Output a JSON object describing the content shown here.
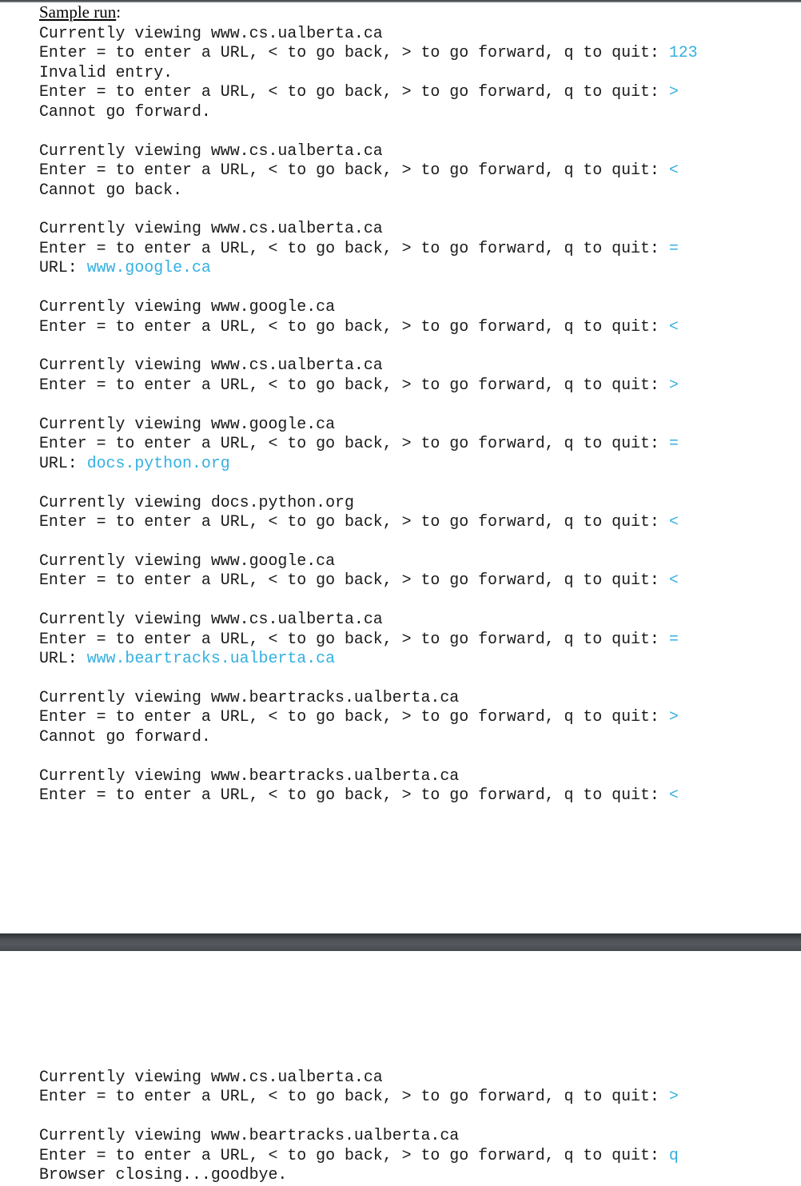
{
  "document": {
    "heading": "Sample run",
    "heading_suffix": ":",
    "input_color": "#35b0e0",
    "page1_lines": [
      {
        "text": "Currently viewing www.cs.ualberta.ca",
        "input": ""
      },
      {
        "text": "Enter = to enter a URL, < to go back, > to go forward, q to quit: ",
        "input": "123"
      },
      {
        "text": "Invalid entry.",
        "input": ""
      },
      {
        "text": "Enter = to enter a URL, < to go back, > to go forward, q to quit: ",
        "input": ">"
      },
      {
        "text": "Cannot go forward.",
        "input": ""
      },
      {
        "text": "",
        "input": ""
      },
      {
        "text": "Currently viewing www.cs.ualberta.ca",
        "input": ""
      },
      {
        "text": "Enter = to enter a URL, < to go back, > to go forward, q to quit: ",
        "input": "<"
      },
      {
        "text": "Cannot go back.",
        "input": ""
      },
      {
        "text": "",
        "input": ""
      },
      {
        "text": "Currently viewing www.cs.ualberta.ca",
        "input": ""
      },
      {
        "text": "Enter = to enter a URL, < to go back, > to go forward, q to quit: ",
        "input": "="
      },
      {
        "text": "URL: ",
        "input": "www.google.ca"
      },
      {
        "text": "",
        "input": ""
      },
      {
        "text": "Currently viewing www.google.ca",
        "input": ""
      },
      {
        "text": "Enter = to enter a URL, < to go back, > to go forward, q to quit: ",
        "input": "<"
      },
      {
        "text": "",
        "input": ""
      },
      {
        "text": "Currently viewing www.cs.ualberta.ca",
        "input": ""
      },
      {
        "text": "Enter = to enter a URL, < to go back, > to go forward, q to quit: ",
        "input": ">"
      },
      {
        "text": "",
        "input": ""
      },
      {
        "text": "Currently viewing www.google.ca",
        "input": ""
      },
      {
        "text": "Enter = to enter a URL, < to go back, > to go forward, q to quit: ",
        "input": "="
      },
      {
        "text": "URL: ",
        "input": "docs.python.org"
      },
      {
        "text": "",
        "input": ""
      },
      {
        "text": "Currently viewing docs.python.org",
        "input": ""
      },
      {
        "text": "Enter = to enter a URL, < to go back, > to go forward, q to quit: ",
        "input": "<"
      },
      {
        "text": "",
        "input": ""
      },
      {
        "text": "Currently viewing www.google.ca",
        "input": ""
      },
      {
        "text": "Enter = to enter a URL, < to go back, > to go forward, q to quit: ",
        "input": "<"
      },
      {
        "text": "",
        "input": ""
      },
      {
        "text": "Currently viewing www.cs.ualberta.ca",
        "input": ""
      },
      {
        "text": "Enter = to enter a URL, < to go back, > to go forward, q to quit: ",
        "input": "="
      },
      {
        "text": "URL: ",
        "input": "www.beartracks.ualberta.ca"
      },
      {
        "text": "",
        "input": ""
      },
      {
        "text": "Currently viewing www.beartracks.ualberta.ca",
        "input": ""
      },
      {
        "text": "Enter = to enter a URL, < to go back, > to go forward, q to quit: ",
        "input": ">"
      },
      {
        "text": "Cannot go forward.",
        "input": ""
      },
      {
        "text": "",
        "input": ""
      },
      {
        "text": "Currently viewing www.beartracks.ualberta.ca",
        "input": ""
      },
      {
        "text": "Enter = to enter a URL, < to go back, > to go forward, q to quit: ",
        "input": "<"
      }
    ],
    "page2_lines": [
      {
        "text": "Currently viewing www.cs.ualberta.ca",
        "input": ""
      },
      {
        "text": "Enter = to enter a URL, < to go back, > to go forward, q to quit: ",
        "input": ">"
      },
      {
        "text": "",
        "input": ""
      },
      {
        "text": "Currently viewing www.beartracks.ualberta.ca",
        "input": ""
      },
      {
        "text": "Enter = to enter a URL, < to go back, > to go forward, q to quit: ",
        "input": "q"
      },
      {
        "text": "Browser closing...goodbye.",
        "input": ""
      }
    ]
  }
}
